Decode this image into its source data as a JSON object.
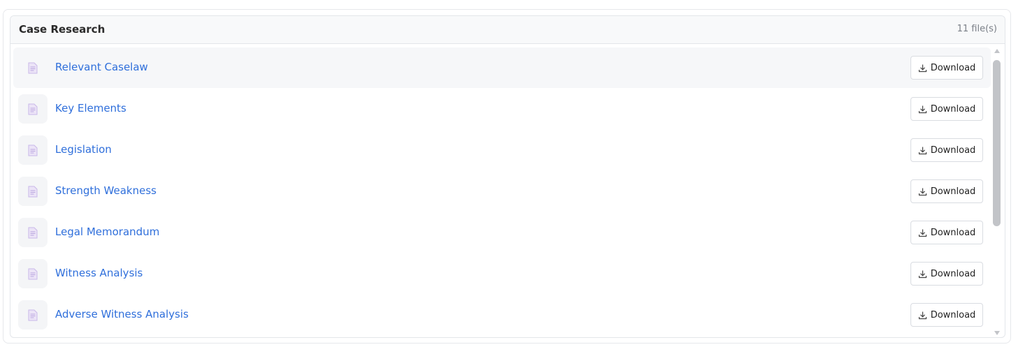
{
  "section": {
    "title": "Case Research",
    "file_count": "11 file(s)"
  },
  "files": [
    {
      "name": "Relevant Caselaw",
      "download_label": "Download"
    },
    {
      "name": "Key Elements",
      "download_label": "Download"
    },
    {
      "name": "Legislation",
      "download_label": "Download"
    },
    {
      "name": "Strength Weakness",
      "download_label": "Download"
    },
    {
      "name": "Legal Memorandum",
      "download_label": "Download"
    },
    {
      "name": "Witness Analysis",
      "download_label": "Download"
    },
    {
      "name": "Adverse Witness Analysis",
      "download_label": "Download"
    }
  ],
  "icons": {
    "file": "document-icon",
    "download": "download-icon"
  },
  "colors": {
    "link": "#2f6fdb",
    "file_icon": "#c9b8e8"
  }
}
